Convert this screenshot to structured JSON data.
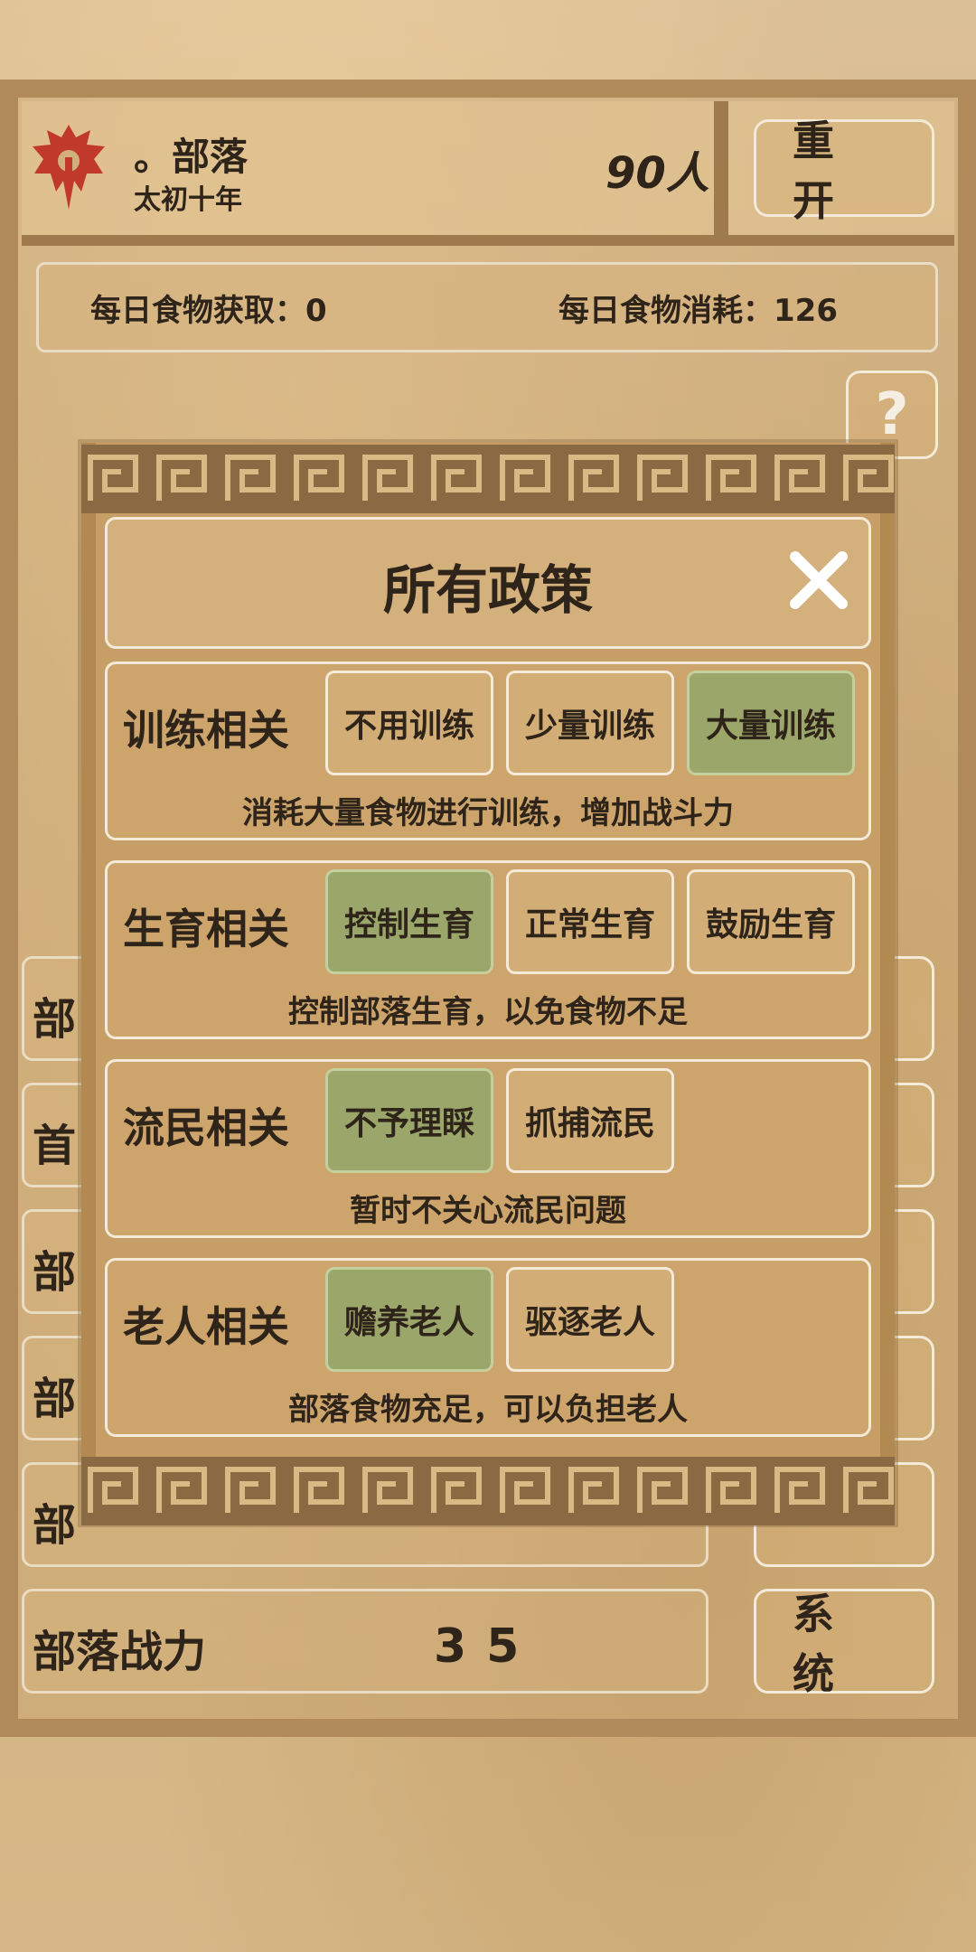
{
  "header": {
    "tribe_name": "。部落",
    "era": "太初十年",
    "population": "90人",
    "restart_label": "重开"
  },
  "food": {
    "gain": "每日食物获取：0",
    "cost": "每日食物消耗：126"
  },
  "help_label": "?",
  "stats": {
    "rows": [
      {
        "label": "部"
      },
      {
        "label": "首"
      },
      {
        "label": "部"
      },
      {
        "label": "部"
      },
      {
        "label": "部"
      },
      {
        "label": "部落战力",
        "value": "35"
      }
    ],
    "system_label": "系统"
  },
  "modal": {
    "title": "所有政策",
    "policies": [
      {
        "category": "训练相关",
        "options": [
          "不用训练",
          "少量训练",
          "大量训练"
        ],
        "selected": 2,
        "description": "消耗大量食物进行训练，增加战斗力"
      },
      {
        "category": "生育相关",
        "options": [
          "控制生育",
          "正常生育",
          "鼓励生育"
        ],
        "selected": 0,
        "description": "控制部落生育，以免食物不足"
      },
      {
        "category": "流民相关",
        "options": [
          "不予理睬",
          "抓捕流民"
        ],
        "selected": 0,
        "description": "暂时不关心流民问题"
      },
      {
        "category": "老人相关",
        "options": [
          "赡养老人",
          "驱逐老人"
        ],
        "selected": 0,
        "description": "部落食物充足，可以负担老人"
      }
    ]
  },
  "colors": {
    "selected_option": "#9aa66a",
    "emblem": "#c0392b"
  }
}
